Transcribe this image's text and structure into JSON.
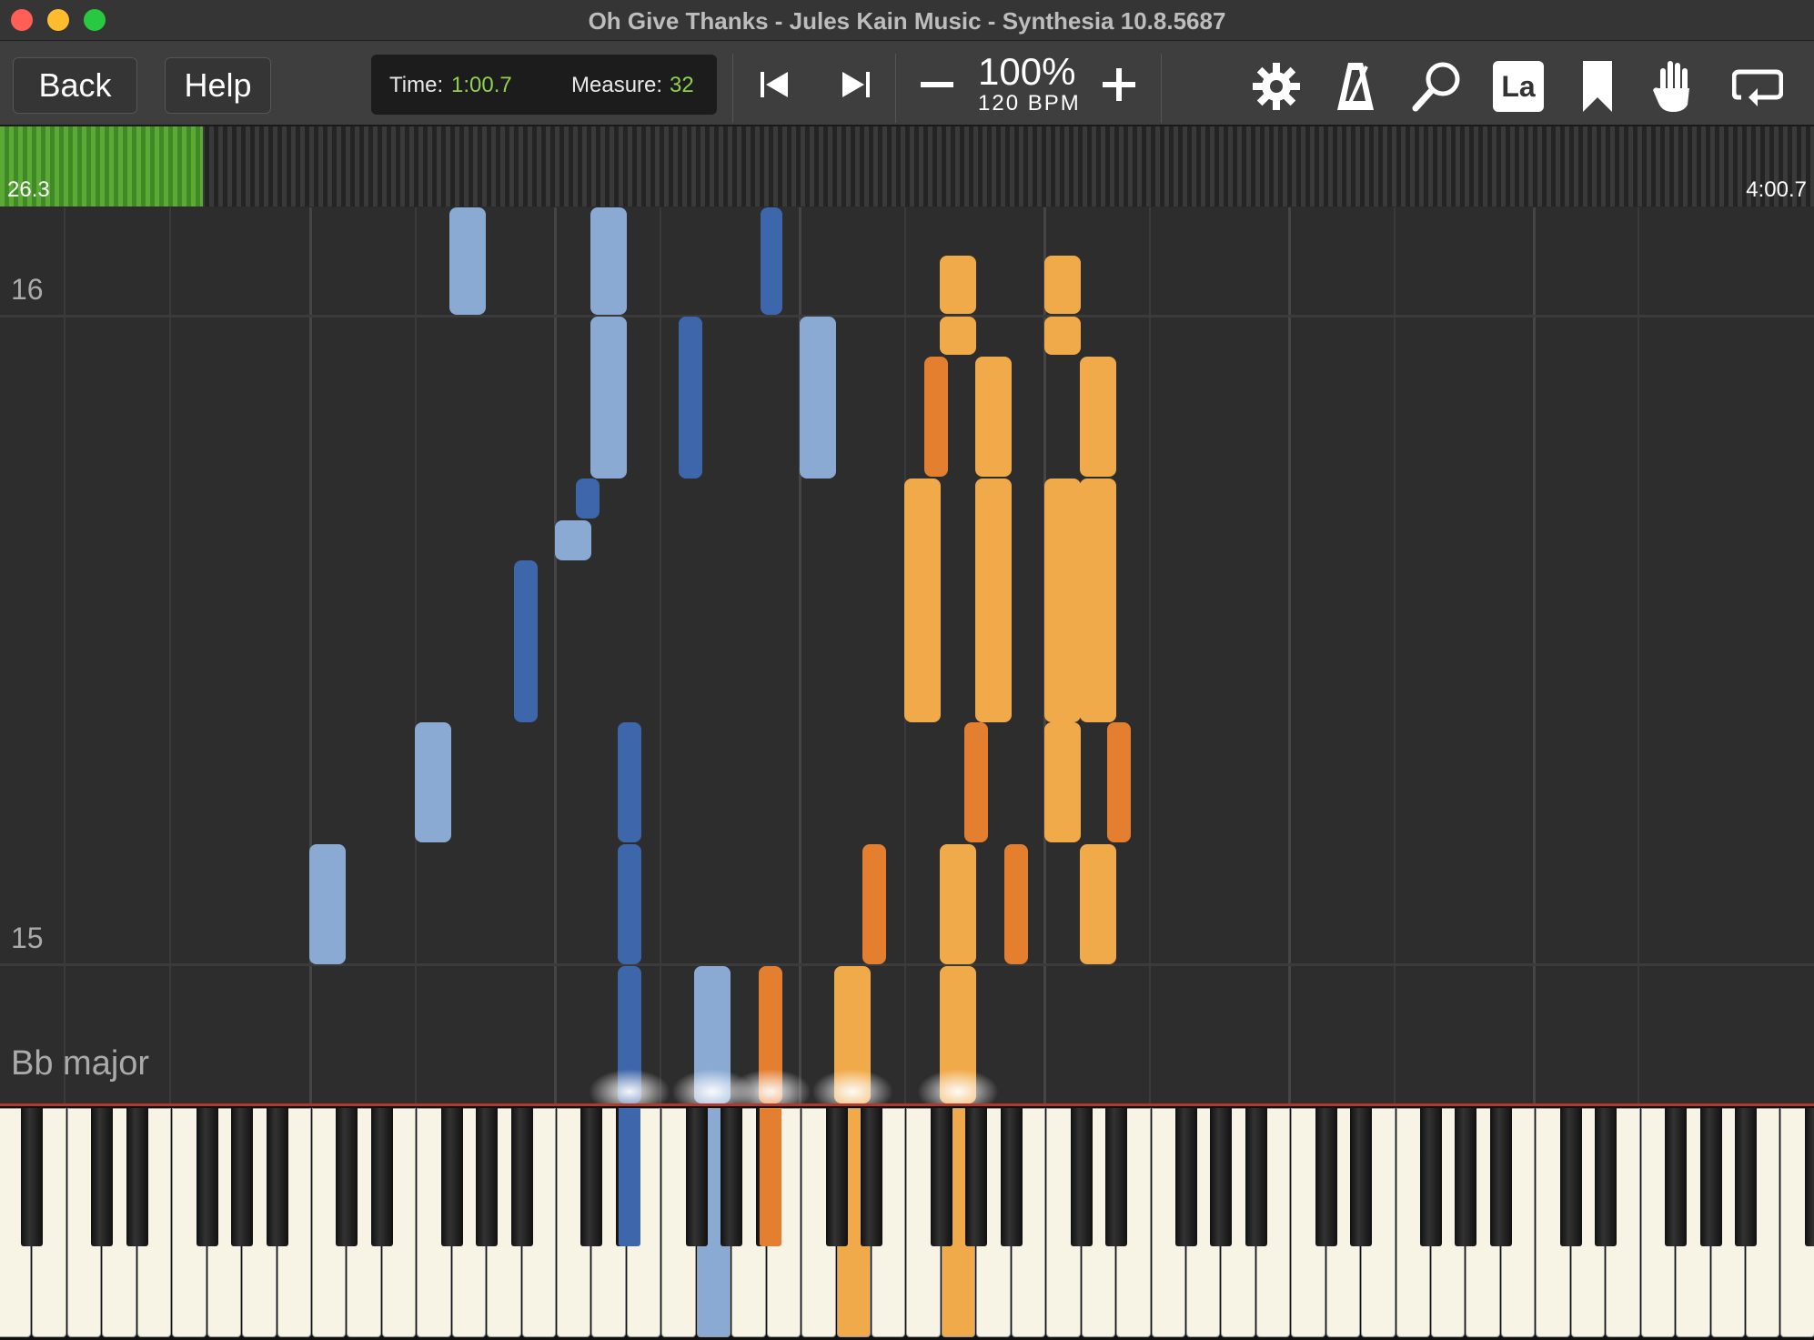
{
  "window": {
    "title": "Oh Give Thanks - Jules Kain Music - Synthesia 10.8.5687",
    "traffic_lights": [
      "#ff5f57",
      "#febc2e",
      "#28c840"
    ]
  },
  "toolbar": {
    "back_label": "Back",
    "help_label": "Help",
    "time_label": "Time:",
    "time_value": "1:00.7",
    "measure_label": "Measure:",
    "measure_value": "32",
    "tempo_percent": "100%",
    "tempo_bpm": "120 BPM",
    "icons": [
      "skip-back-icon",
      "skip-forward-icon",
      "minus-icon",
      "plus-icon",
      "gear-icon",
      "metronome-icon",
      "magnifier-icon",
      "solfege-la-icon",
      "bookmark-icon",
      "hand-icon",
      "loop-icon"
    ],
    "solfege_label": "La"
  },
  "timeline": {
    "start": "26.3",
    "end": "4:00.7",
    "progress_fraction": 0.112
  },
  "roll": {
    "measure_labels": [
      "16",
      "15"
    ],
    "key_signature": "Bb major"
  },
  "colors": {
    "left_hand_light": "#8aaad4",
    "left_hand_dark": "#3e66aa",
    "right_hand_light": "#f0aa4a",
    "right_hand_dark": "#e47f30",
    "progress": "#5aaa35"
  }
}
